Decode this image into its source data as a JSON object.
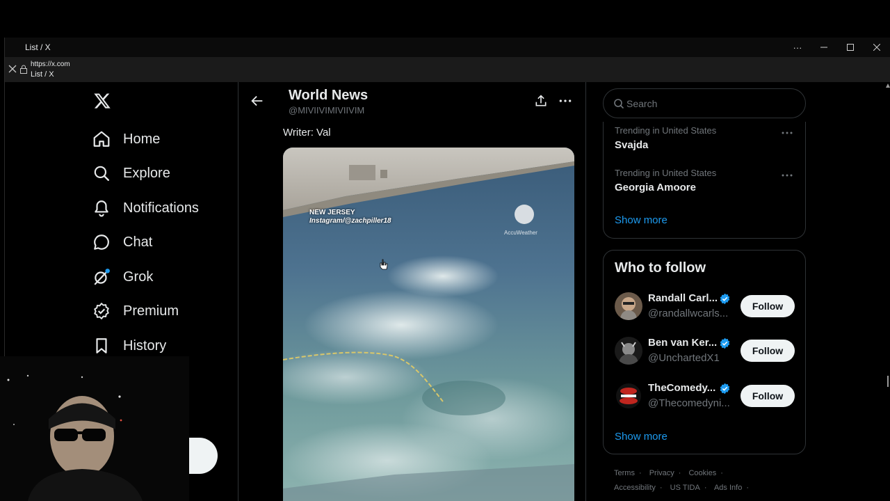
{
  "window": {
    "title": "List / X",
    "controls": [
      "...",
      "—",
      "☐",
      "✕"
    ]
  },
  "urlbar": {
    "url": "https://x.com",
    "page_title": "List / X"
  },
  "nav": {
    "items": [
      {
        "label": "Home",
        "icon": "home-icon"
      },
      {
        "label": "Explore",
        "icon": "search-icon"
      },
      {
        "label": "Notifications",
        "icon": "bell-icon"
      },
      {
        "label": "Chat",
        "icon": "chat-bubble-icon"
      },
      {
        "label": "Grok",
        "icon": "grok-icon"
      },
      {
        "label": "Premium",
        "icon": "verified-badge-icon"
      },
      {
        "label": "History",
        "icon": "bookmark-icon"
      }
    ]
  },
  "header": {
    "title": "World News",
    "handle": "@MIVIIVIMIVIIVIM"
  },
  "post": {
    "writer": "Writer: Val",
    "overlay_location": "NEW JERSEY",
    "overlay_credit": "Instagram/@zachpiller18",
    "watermark": "AccuWeather"
  },
  "search": {
    "placeholder": "Search"
  },
  "trends": [
    {
      "context": "Trending in United States",
      "name": "Svajda"
    },
    {
      "context": "Trending in United States",
      "name": "Georgia Amoore"
    }
  ],
  "trends_show_more": "Show more",
  "who_to_follow": {
    "title": "Who to follow",
    "accounts": [
      {
        "name": "Randall Carl...",
        "handle": "@randallwcarls...",
        "button": "Follow"
      },
      {
        "name": "Ben van Ker...",
        "handle": "@UnchartedX1",
        "button": "Follow"
      },
      {
        "name": "TheComedy...",
        "handle": "@Thecomedyni...",
        "button": "Follow"
      }
    ],
    "show_more": "Show more"
  },
  "footer": {
    "links": [
      "Terms",
      "Privacy",
      "Cookies",
      "Accessibility",
      "US TIDA",
      "Ads Info"
    ]
  },
  "colors": {
    "accent": "#1d9bf0",
    "background": "#000000",
    "text_primary": "#e7e9ea",
    "text_secondary": "#71767b",
    "border": "#2f3336"
  }
}
